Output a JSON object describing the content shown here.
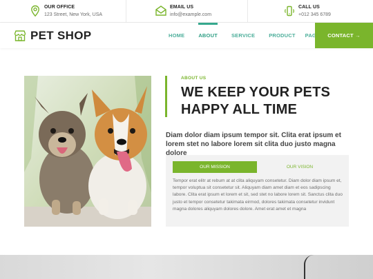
{
  "topbar": {
    "office": {
      "title": "OUR OFFICE",
      "value": "123 Street, New York, USA",
      "icon": "map-pin-icon"
    },
    "email": {
      "title": "EMAIL US",
      "value": "info@example.com",
      "icon": "envelope-icon"
    },
    "call": {
      "title": "CALL US",
      "value": "+012 345 6789",
      "icon": "phone-icon"
    }
  },
  "nav": {
    "brand": "PET SHOP",
    "links": [
      "HOME",
      "ABOUT",
      "SERVICE",
      "PRODUCT",
      "PAGES"
    ],
    "active": "ABOUT",
    "contact": "CONTACT →"
  },
  "about": {
    "label": "ABOUT US",
    "title": "WE KEEP YOUR PETS HAPPY ALL TIME",
    "lead": "Diam dolor diam ipsum tempor sit. Clita erat ipsum et lorem stet no labore lorem sit clita duo justo magna dolore",
    "tabs": [
      "OUR MISSION",
      "OUR VISION"
    ],
    "active_tab": "OUR MISSION",
    "body": "Tempor erat elitr at rebum at at clita aliquyam consetetur. Diam dolor diam ipsum et, tempor voluptua sit consetetur sit. Aliquyam diam amet diam et eos sadipscing labore. Clita erat ipsum et lorem et sit, sed stet no labore lorem sit. Sanctus clita duo justo et tempor consetetur takimata eirmod, dolores takimata consetetur invidunt magna dolores aliquyam dolores dolore. Amet erat amet et magna"
  },
  "colors": {
    "accent_green": "#7ab52c",
    "nav_teal": "#4cae9a",
    "text_dark": "#222222"
  }
}
